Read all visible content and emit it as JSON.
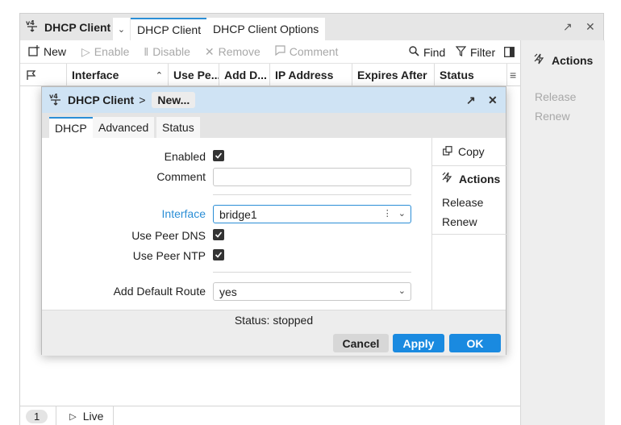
{
  "window": {
    "title": "DHCP Client",
    "tabs": [
      "DHCP Client",
      "DHCP Client Options"
    ]
  },
  "toolbar": {
    "new": "New",
    "enable": "Enable",
    "disable": "Disable",
    "remove": "Remove",
    "comment": "Comment",
    "find": "Find",
    "filter": "Filter"
  },
  "table": {
    "columns": [
      "Interface",
      "Use Pe...",
      "Add D...",
      "IP Address",
      "Expires After",
      "Status"
    ]
  },
  "actions_panel": {
    "title": "Actions",
    "items": [
      "Release",
      "Renew"
    ]
  },
  "statusbar": {
    "count": "1",
    "live": "Live"
  },
  "dialog": {
    "title": "DHCP Client",
    "separator": ">",
    "crumb": "New...",
    "tabs": [
      "DHCP",
      "Advanced",
      "Status"
    ],
    "fields": {
      "enabled_label": "Enabled",
      "comment_label": "Comment",
      "comment_value": "",
      "interface_label": "Interface",
      "interface_value": "bridge1",
      "use_peer_dns_label": "Use Peer DNS",
      "use_peer_ntp_label": "Use Peer NTP",
      "add_default_route_label": "Add Default Route",
      "add_default_route_value": "yes"
    },
    "side": {
      "copy": "Copy",
      "actions_title": "Actions",
      "release": "Release",
      "renew": "Renew"
    },
    "status_text": "Status: stopped",
    "buttons": {
      "cancel": "Cancel",
      "apply": "Apply",
      "ok": "OK"
    }
  },
  "colors": {
    "accent": "#2b8ed6",
    "primary_button": "#1a8ae0",
    "dialog_title_bg": "#cfe3f4"
  }
}
